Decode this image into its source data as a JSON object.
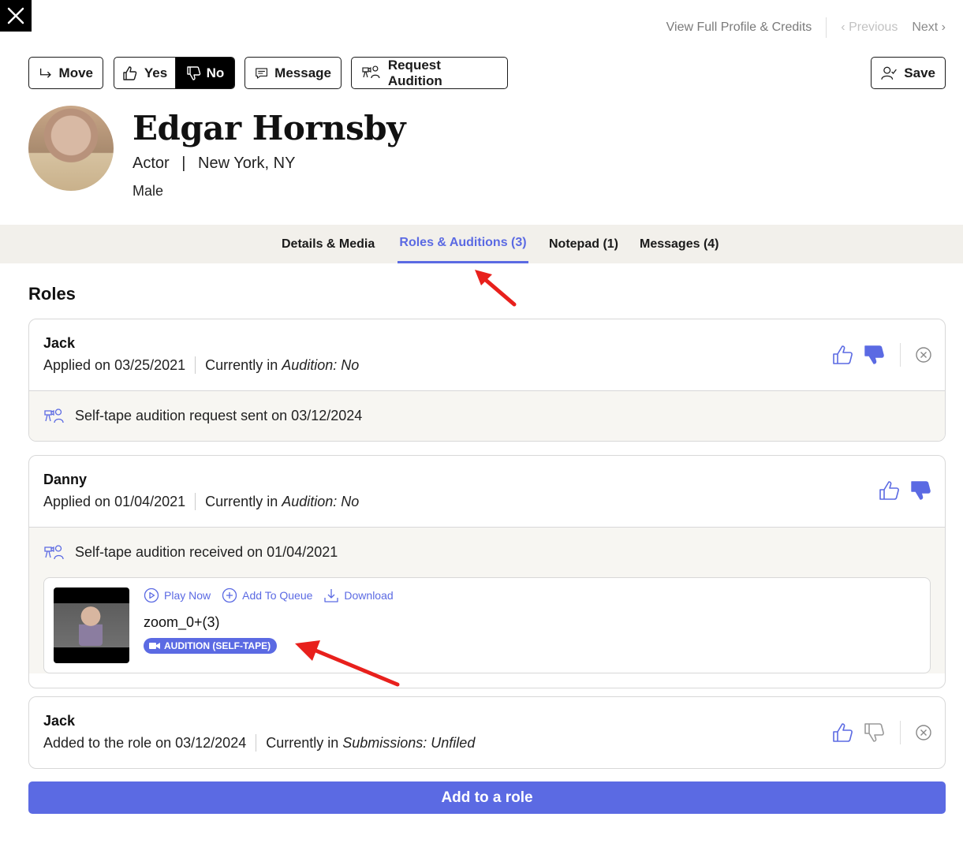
{
  "topnav": {
    "full_profile": "View Full Profile & Credits",
    "previous": "‹ Previous",
    "next": "Next ›"
  },
  "toolbar": {
    "move": "Move",
    "yes": "Yes",
    "no": "No",
    "message": "Message",
    "request_audition": "Request Audition",
    "save": "Save"
  },
  "profile": {
    "name": "Edgar Hornsby",
    "role": "Actor",
    "separator": "|",
    "location": "New York, NY",
    "gender": "Male"
  },
  "tabs": [
    {
      "label": "Details & Media",
      "active": false
    },
    {
      "label": "Roles & Auditions (3)",
      "active": true
    },
    {
      "label": "Notepad (1)",
      "active": false
    },
    {
      "label": "Messages (4)",
      "active": false
    }
  ],
  "roles_title": "Roles",
  "roles": [
    {
      "name": "Jack",
      "applied": "Applied on 03/25/2021",
      "status_prefix": "Currently in ",
      "status": "Audition: No",
      "footer": "Self-tape audition request sent on 03/12/2024"
    },
    {
      "name": "Danny",
      "applied": "Applied on 01/04/2021",
      "status_prefix": "Currently in ",
      "status": "Audition: No",
      "footer": "Self-tape audition received on 01/04/2021",
      "media": {
        "play": "Play Now",
        "queue": "Add To Queue",
        "download": "Download",
        "title": "zoom_0+(3)",
        "badge": "AUDITION (SELF-TAPE)"
      }
    },
    {
      "name": "Jack",
      "applied": "Added to the role on 03/12/2024",
      "status_prefix": "Currently in ",
      "status": "Submissions: Unfiled"
    }
  ],
  "add_role": "Add to a role",
  "colors": {
    "accent": "#5b6ae3",
    "annotation_arrow": "#e8201c"
  }
}
